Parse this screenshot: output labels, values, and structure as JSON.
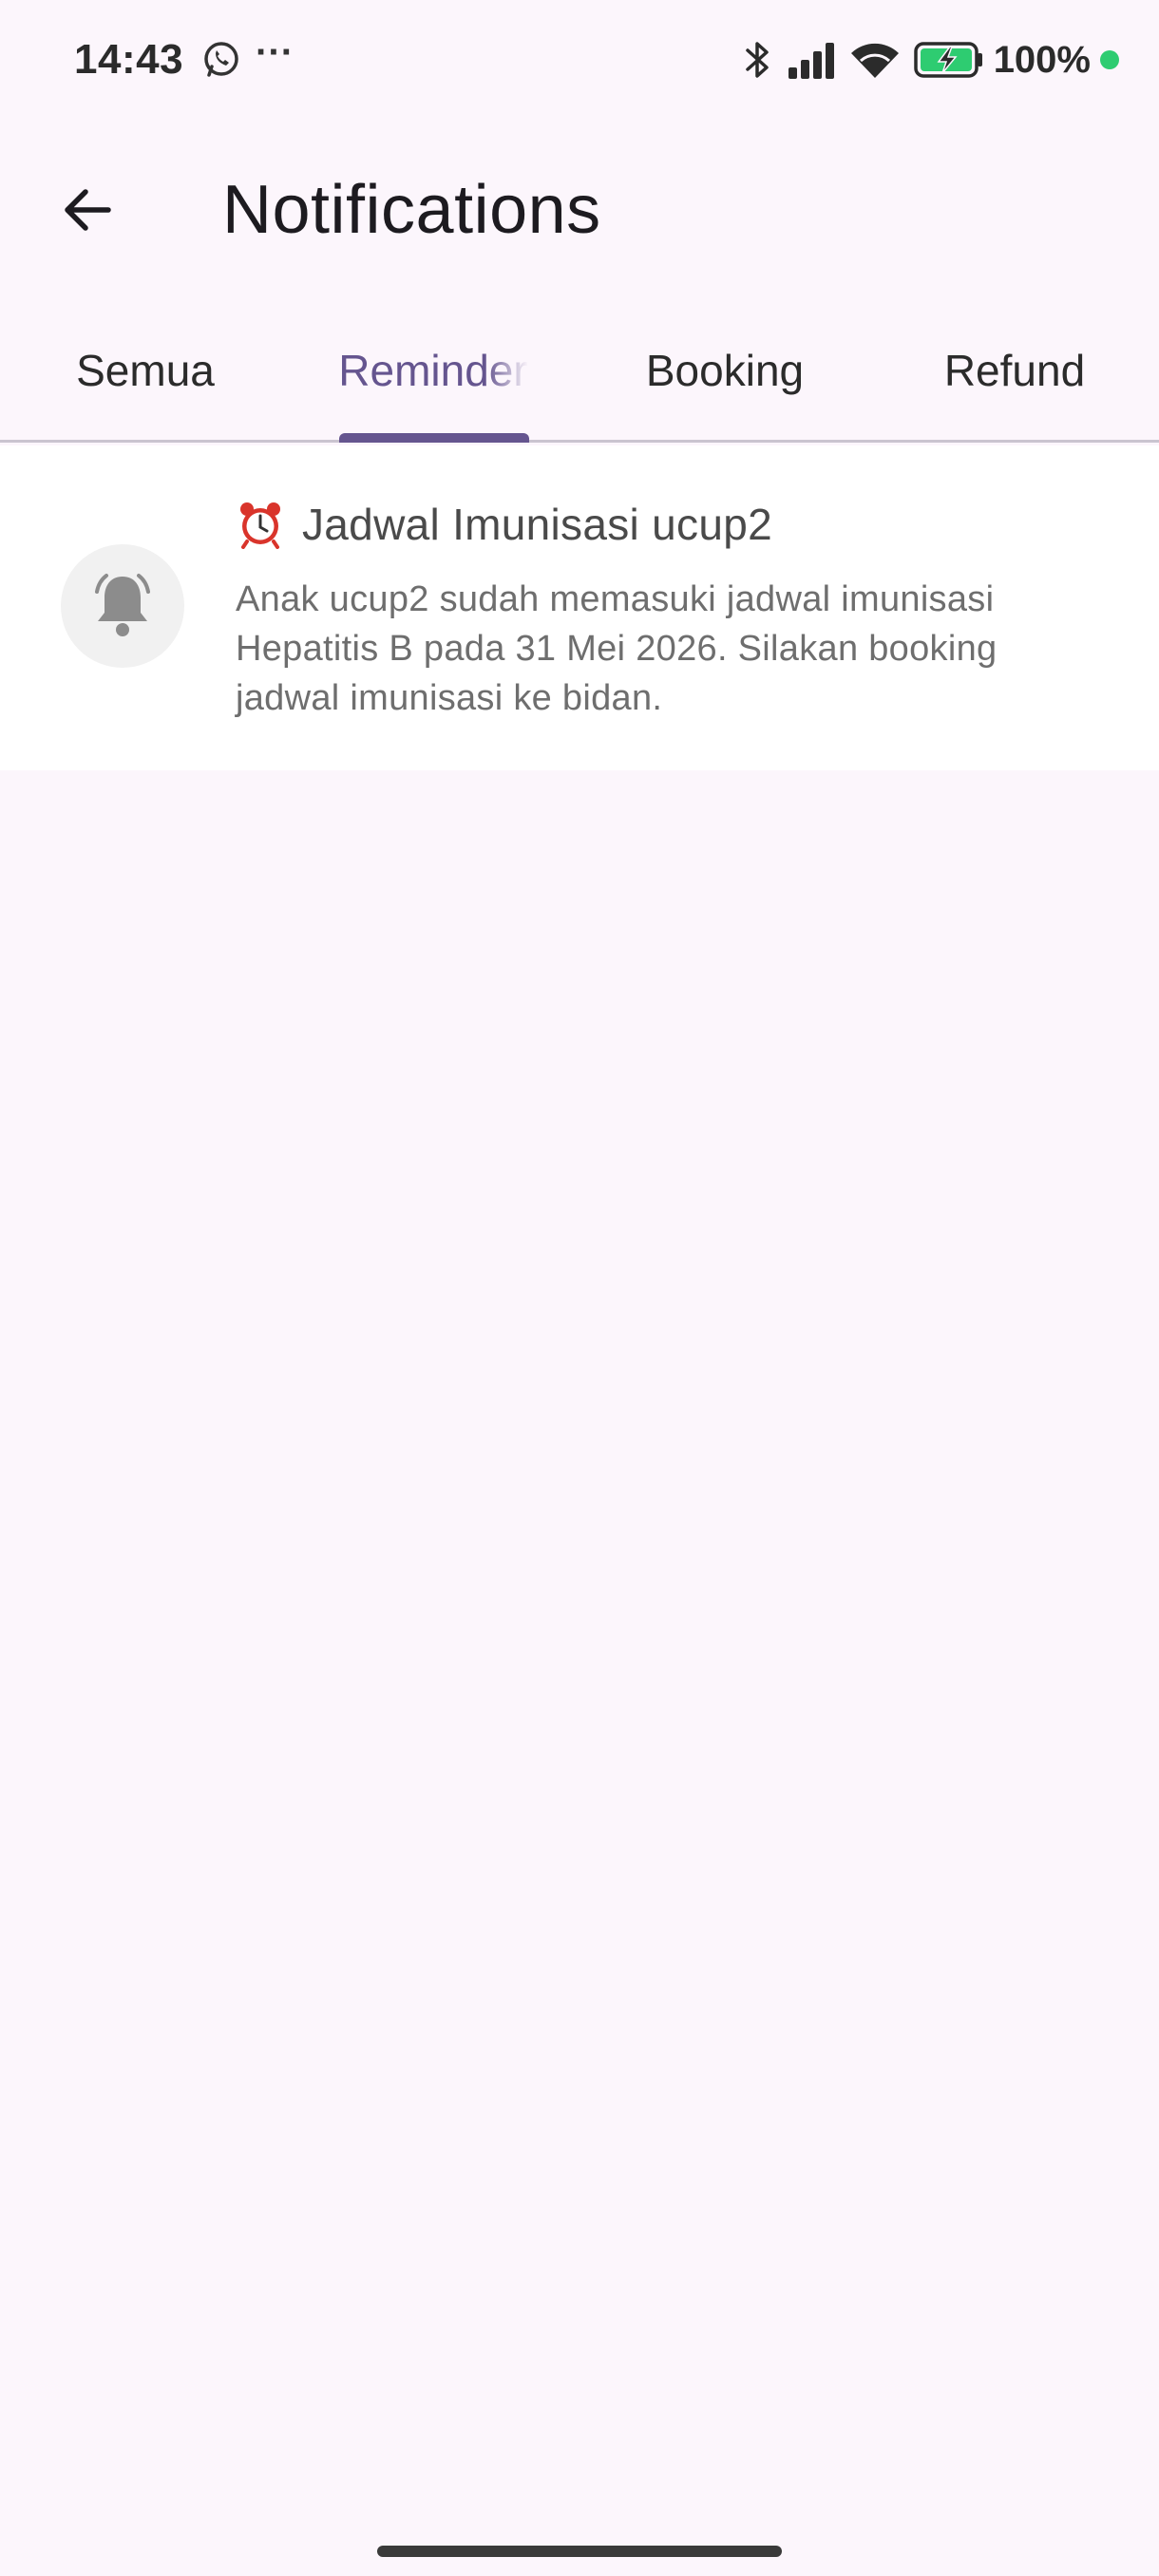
{
  "status_bar": {
    "time": "14:43",
    "battery_text": "100%",
    "icons": [
      "whatsapp-icon",
      "more-icon",
      "bluetooth-icon",
      "signal-icon",
      "wifi-icon",
      "battery-charging-icon"
    ],
    "more_glyph": "···"
  },
  "app_bar": {
    "title": "Notifications",
    "back_icon": "arrow-back-icon"
  },
  "tabs": {
    "items": [
      {
        "label": "Semua",
        "active": false
      },
      {
        "label": "Reminder",
        "active": true
      },
      {
        "label": "Booking",
        "active": false
      },
      {
        "label": "Refund",
        "active": false
      }
    ]
  },
  "notifications": [
    {
      "icon": "bell-icon",
      "title_icon": "alarm-clock-icon",
      "title": "Jadwal Imunisasi ucup2",
      "body": "Anak ucup2 sudah memasuki jadwal imunisasi Hepatitis B pada 31 Mei 2026. Silakan booking jadwal imunisasi ke bidan."
    }
  ],
  "colors": {
    "background": "#FCF6FC",
    "accent": "#65558F",
    "card": "#FFFFFF",
    "status_dot": "#2ECC71"
  }
}
